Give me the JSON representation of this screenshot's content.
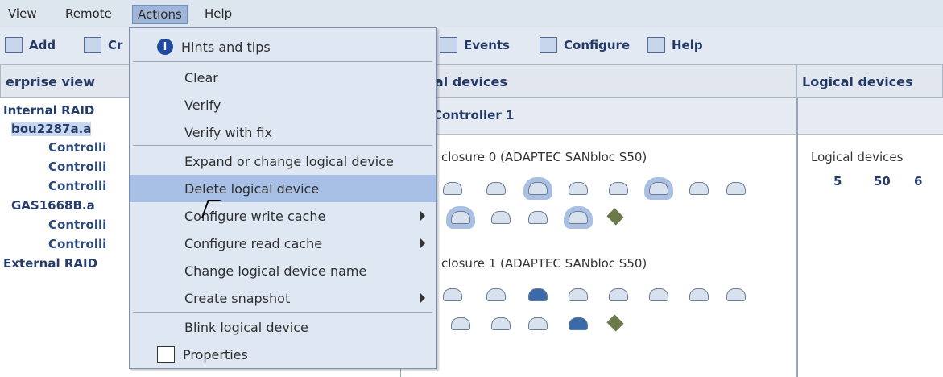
{
  "menubar": {
    "items": [
      "View",
      "Remote",
      "Actions",
      "Help"
    ]
  },
  "toolbar": {
    "add": "Add",
    "create": "Cr",
    "events": "Events",
    "configure": "Configure",
    "help": "Help"
  },
  "panels": {
    "left_title": "erprise view",
    "middle_title": "ysical devices",
    "right_title": "Logical devices"
  },
  "tree": {
    "internal_raid": "Internal RAID",
    "host1": "bou2287a.a",
    "controllers1": [
      "Controlli",
      "Controlli",
      "Controlli"
    ],
    "host2": "GAS1668B.a",
    "controllers2": [
      "Controlli",
      "Controlli"
    ],
    "external_raid": "External RAID"
  },
  "middle": {
    "controller": "Controller 1",
    "enclosure0": "closure 0 (ADAPTEC SANbloc S50)",
    "enclosure1": "closure 1 (ADAPTEC SANbloc S50)"
  },
  "right": {
    "logical_devices_label": "Logical devices",
    "devices": [
      "5",
      "50",
      "6"
    ]
  },
  "actions_menu": {
    "hints": "Hints and tips",
    "clear": "Clear",
    "verify": "Verify",
    "verify_fix": "Verify with fix",
    "expand": "Expand or change logical device",
    "delete": "Delete logical device",
    "write_cache": "Configure write cache",
    "read_cache": "Configure read cache",
    "change_name": "Change logical device name",
    "snapshot": "Create snapshot",
    "blink": "Blink logical device",
    "properties": "Properties"
  }
}
